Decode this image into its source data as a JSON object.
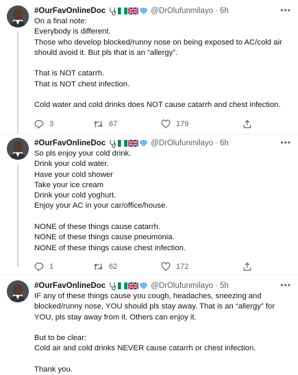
{
  "tweets": [
    {
      "author": "#OurFavOnlineDoc",
      "handle": "@DrOlufunmilayo",
      "dot": "·",
      "time": "6h",
      "text": "On a final note:\nEverybody is different.\nThose who develop blocked/runny nose on being exposed to AC/cold air\nshould avoid it. But pls that is an “allergy”.\n\nThat is NOT catarrh.\nThat is NOT chest infection.\n\nCold water and cold drinks does NOT cause catarrh and chest infection.",
      "replies": "3",
      "retweets": "67",
      "likes": "179"
    },
    {
      "author": "#OurFavOnlineDoc",
      "handle": "@DrOlufunmilayo",
      "dot": "·",
      "time": "6h",
      "text": "So pls enjoy your cold drink.\nDrink your cold water.\nHave your cold shower\nTake your ice cream\nDrink your cold yoghurt.\nEnjoy your AC in your car/office/house.\n\nNONE of these things cause catarrh.\nNONE of these things cause pneumonia.\nNONE of these things cause chest infection.",
      "replies": "1",
      "retweets": "62",
      "likes": "172"
    },
    {
      "author": "#OurFavOnlineDoc",
      "handle": "@DrOlufunmilayo",
      "dot": "·",
      "time": "5h",
      "text": "IF any of these things cause you cough, headaches, sneezing and\nblocked/runny nose, YOU should pls stay away. That is an “allergy” for\nYOU, pls stay away from it. Others can enjoy it.\n\nBut to be clear:\nCold air and cold drinks NEVER cause catarrh or chest infection.\n\nThank you."
    }
  ],
  "icons": {
    "more": "more-horizontal-icon",
    "reply": "reply-icon",
    "retweet": "retweet-icon",
    "like": "heart-icon",
    "share": "share-icon",
    "badges": [
      "stethoscope-icon",
      "nigeria-flag-icon",
      "uk-flag-icon",
      "diamond-icon"
    ]
  },
  "colors": {
    "text": "#0f1419",
    "secondary": "#536471",
    "thread_line": "#cfd9de",
    "nigeria_green": "#008751",
    "diamond": "#4aa8e8"
  }
}
